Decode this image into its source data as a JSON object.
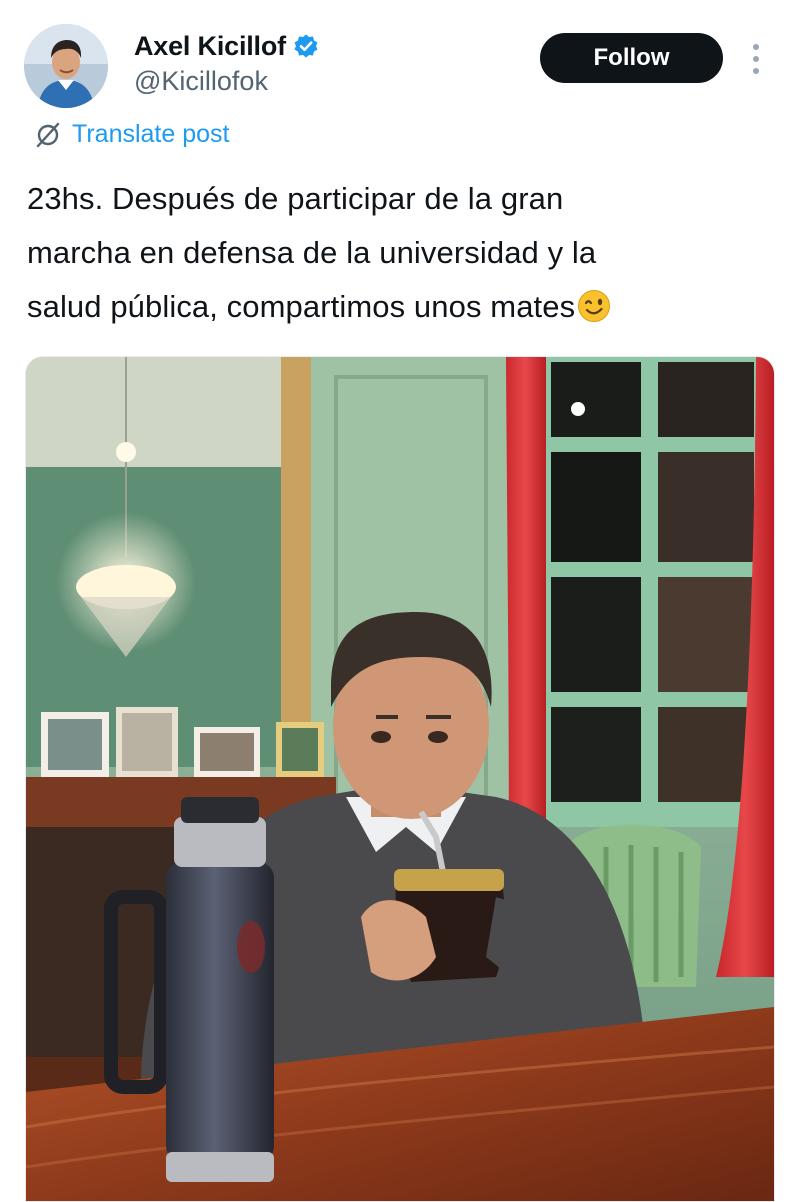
{
  "author": {
    "display_name": "Axel Kicillof",
    "handle": "@Kicillofok",
    "verified": true,
    "avatar_icon": "avatar-photo"
  },
  "actions": {
    "follow_label": "Follow",
    "more_icon": "more-options-icon"
  },
  "translate": {
    "label": "Translate post",
    "icon": "translate-globe-icon"
  },
  "post": {
    "lines": [
      "23hs. Después de participar de la gran",
      "marcha en defensa de la universidad y la",
      "salud pública, compartimos unos mates"
    ],
    "emoji": "winking-face-emoji"
  },
  "media": {
    "type": "photo",
    "icon": "photo-man-drinking-mate"
  },
  "colors": {
    "accent": "#1d9bf0",
    "text_primary": "#0f1419",
    "text_secondary": "#536471",
    "follow_bg": "#0f1419",
    "follow_text": "#ffffff"
  }
}
